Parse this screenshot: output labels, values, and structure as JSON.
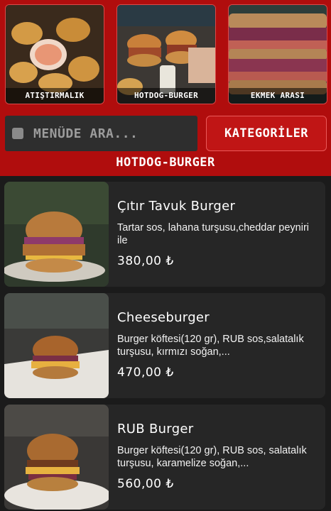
{
  "categories": [
    {
      "label": "ATIŞTIRMALIK"
    },
    {
      "label": "HOTDOG-BURGER"
    },
    {
      "label": "EKMEK ARASI"
    }
  ],
  "search": {
    "placeholder": "MENÜDE ARA..."
  },
  "categories_button": {
    "label": "KATEGORİLER"
  },
  "section_title": "HOTDOG-BURGER",
  "items": [
    {
      "name": "Çıtır Tavuk Burger",
      "description": "Tartar sos, lahana turşusu,cheddar peyniri ile",
      "price": "380,00 ₺"
    },
    {
      "name": "Cheeseburger",
      "description": "Burger köftesi(120 gr), RUB sos,salatalık turşusu, kırmızı soğan,...",
      "price": "470,00 ₺"
    },
    {
      "name": "RUB Burger",
      "description": "Burger köftesi(120 gr), RUB sos, salatalık turşusu, karamelize soğan,...",
      "price": "560,00 ₺"
    }
  ],
  "colors": {
    "header_red": "#b00d0d",
    "background": "#1b1b1b",
    "card": "#262626"
  }
}
